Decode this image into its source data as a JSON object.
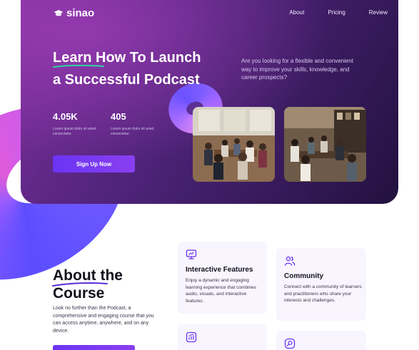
{
  "nav": {
    "logo_text": "sinao",
    "links": [
      "About",
      "Pricing",
      "Review"
    ]
  },
  "hero": {
    "title_line1": "Learn How To Launch",
    "title_line2": "a Successful Podcast",
    "description": "Are you looking for a flexible and convenient way to improve your skills, knowledge, and career prospects?",
    "stats": [
      {
        "value": "4.05K",
        "caption": "Lorem ipsum dolor sit amet consectetur."
      },
      {
        "value": "405",
        "caption": "Lorem ipsum dolor sit amet consectetur."
      }
    ],
    "cta_label": "Sign Up Now"
  },
  "about": {
    "title_line1": "About the",
    "title_line2": "Course",
    "description": "Look no further than the Podcast, a comprehensive and engaging course that you can access anytime, anywhere, and on any device."
  },
  "features": [
    {
      "icon": "monitor-icon",
      "title": "Interactive Features",
      "text": "Enjoy a dynamic and engaging learning experience that combines audio, visuals, and interactive features."
    },
    {
      "icon": "users-icon",
      "title": "Community",
      "text": "Connect with a community of learners and practitioners who share your interests and challenges."
    },
    {
      "icon": "chart-icon",
      "title": "",
      "text": ""
    },
    {
      "icon": "search-icon",
      "title": "",
      "text": ""
    }
  ],
  "colors": {
    "accent": "#6a34f4",
    "hero_dark": "#22113f",
    "card_bg": "#f8f5ff",
    "underline_green": "#2ed3a6"
  }
}
